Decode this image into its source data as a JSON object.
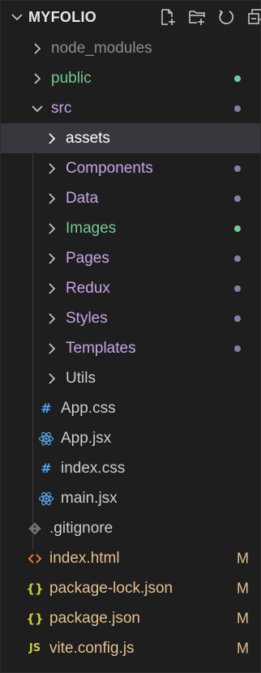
{
  "explorer": {
    "title": "MYFOLIO",
    "header_icons": [
      "new-file-icon",
      "new-folder-icon",
      "refresh-icon",
      "collapse-all-icon"
    ]
  },
  "tree": {
    "items": [
      {
        "label": "node_modules",
        "type": "folder",
        "expanded": false,
        "color": "#8c8c8c"
      },
      {
        "label": "public",
        "type": "folder",
        "expanded": false,
        "color": "#73c991",
        "dot": "#73c991"
      },
      {
        "label": "src",
        "type": "folder",
        "expanded": true,
        "color": "#c5a5e6",
        "dot": "#8b7aa6"
      },
      {
        "label": "assets",
        "type": "folder",
        "expanded": false,
        "color": "#ffffff",
        "selected": true
      },
      {
        "label": "Components",
        "type": "folder",
        "expanded": false,
        "color": "#c5a5e6",
        "dot": "#8b7aa6"
      },
      {
        "label": "Data",
        "type": "folder",
        "expanded": false,
        "color": "#c5a5e6",
        "dot": "#8b7aa6"
      },
      {
        "label": "Images",
        "type": "folder",
        "expanded": false,
        "color": "#73c991",
        "dot": "#73c991"
      },
      {
        "label": "Pages",
        "type": "folder",
        "expanded": false,
        "color": "#c5a5e6",
        "dot": "#8b7aa6"
      },
      {
        "label": "Redux",
        "type": "folder",
        "expanded": false,
        "color": "#c5a5e6",
        "dot": "#8b7aa6"
      },
      {
        "label": "Styles",
        "type": "folder",
        "expanded": false,
        "color": "#c5a5e6",
        "dot": "#8b7aa6"
      },
      {
        "label": "Templates",
        "type": "folder",
        "expanded": false,
        "color": "#c5a5e6",
        "dot": "#8b7aa6"
      },
      {
        "label": "Utils",
        "type": "folder",
        "expanded": false,
        "color": "#cccccc"
      },
      {
        "label": "App.css",
        "type": "file",
        "icon": "css-hash-icon",
        "color": "#cccccc"
      },
      {
        "label": "App.jsx",
        "type": "file",
        "icon": "react-icon",
        "color": "#cccccc"
      },
      {
        "label": "index.css",
        "type": "file",
        "icon": "css-hash-icon",
        "color": "#cccccc"
      },
      {
        "label": "main.jsx",
        "type": "file",
        "icon": "react-icon",
        "color": "#cccccc"
      },
      {
        "label": ".gitignore",
        "type": "file",
        "icon": "git-icon",
        "color": "#cccccc"
      },
      {
        "label": "index.html",
        "type": "file",
        "icon": "html-icon",
        "color": "#e2c08d",
        "badge": "M"
      },
      {
        "label": "package-lock.json",
        "type": "file",
        "icon": "json-icon",
        "color": "#e2c08d",
        "badge": "M"
      },
      {
        "label": "package.json",
        "type": "file",
        "icon": "json-icon",
        "color": "#e2c08d",
        "badge": "M"
      },
      {
        "label": "vite.config.js",
        "type": "file",
        "icon": "js-icon",
        "color": "#e2c08d",
        "badge": "M"
      }
    ]
  }
}
